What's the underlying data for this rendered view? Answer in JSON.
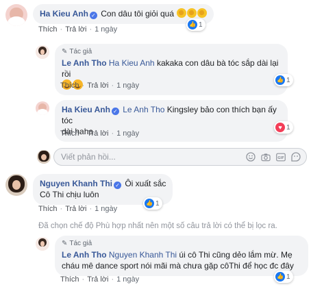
{
  "comments": [
    {
      "author": "Ha Kieu Anh",
      "text": "Con dâu tôi giỏi quá",
      "actions": {
        "like": "Thích",
        "reply": "Trả lời",
        "time": "1 ngày"
      },
      "reaction": {
        "type": "like",
        "count": "1"
      }
    },
    {
      "tag": "Tác giả",
      "author": "Le Anh Tho",
      "mention": "Ha Kieu Anh",
      "text": "kakaka con dâu bà tóc sắp dài lại rồi",
      "actions": {
        "like": "Thích",
        "reply": "Trả lời",
        "time": "1 ngày"
      },
      "reaction": {
        "type": "like",
        "count": "1"
      }
    },
    {
      "author": "Ha Kieu Anh",
      "mention": "Le Anh Tho",
      "text_line1": "Kingsley bảo con thích bạn ấy tóc",
      "text_line2": "dài haha",
      "actions": {
        "like": "Thích",
        "reply": "Trả lời",
        "time": "1 ngày"
      },
      "reaction": {
        "type": "love",
        "count": "1"
      }
    },
    {
      "author": "Nguyen Khanh Thi",
      "text_line1": "Ôi xuất sắc",
      "text_line2": "Cô Thi chịu luôn",
      "actions": {
        "like": "Thích",
        "reply": "Trả lời",
        "time": "1 ngày"
      },
      "reaction": {
        "type": "like",
        "count": "1"
      }
    },
    {
      "tag": "Tác giả",
      "author": "Le Anh Tho",
      "mention": "Nguyen Khanh Thi",
      "text_line1": "úi cô Thi cũng dẻo lắm mừ. Mẹ",
      "text_line2": "cháu mê dance sport nói mãi mà chưa gặp côThi để học đc đây",
      "actions": {
        "like": "Thích",
        "reply": "Trả lời",
        "time": "1 ngày"
      },
      "reaction": {
        "type": "like",
        "count": "1"
      }
    }
  ],
  "reply_box": {
    "placeholder": "Viết phản hồi..."
  },
  "filter_notice": "Đã chọn chế độ Phù hợp nhất nên một số câu trả lời có thể bị lọc ra.",
  "colors": {
    "link": "#385898",
    "bubble": "#f2f3f5",
    "like": "#1877f2",
    "love": "#f33e58"
  }
}
